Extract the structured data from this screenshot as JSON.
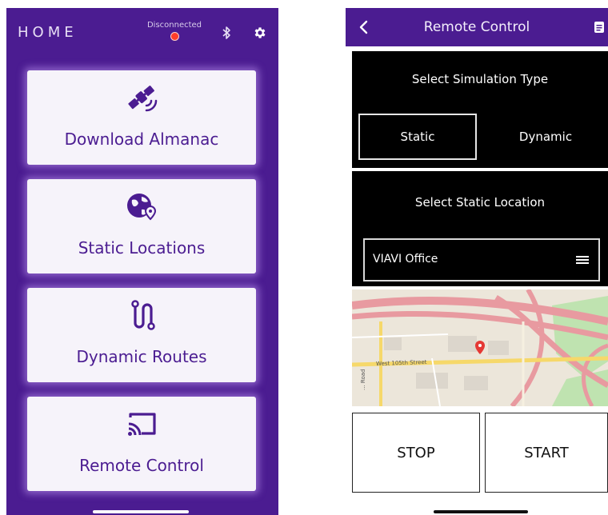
{
  "home": {
    "title": "HOME",
    "connection_status": "Disconnected",
    "cards": [
      {
        "label": "Download Almanac",
        "icon": "satellite-icon"
      },
      {
        "label": "Static Locations",
        "icon": "globe-pin-icon"
      },
      {
        "label": "Dynamic Routes",
        "icon": "route-icon"
      },
      {
        "label": "Remote Control",
        "icon": "cast-icon"
      }
    ]
  },
  "remote": {
    "title": "Remote Control",
    "sim_type_label": "Select Simulation Type",
    "sim_options": [
      "Static",
      "Dynamic"
    ],
    "selected_sim": "Static",
    "static_location_label": "Select Static Location",
    "static_location_value": "VIAVI Office",
    "map": {
      "street_label": "West 105th Street",
      "street_label_vertical": "... Road"
    },
    "stop_label": "STOP",
    "start_label": "START"
  },
  "colors": {
    "brand_purple": "#4b1c91",
    "status_red": "#ff3d2a",
    "pin_red": "#e53935"
  }
}
